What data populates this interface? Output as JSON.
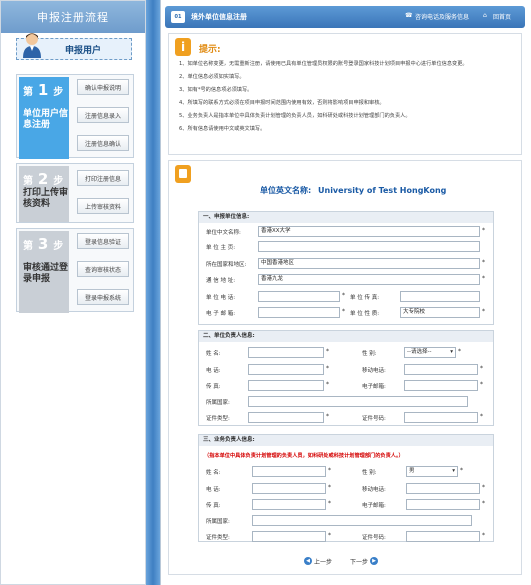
{
  "sidebar": {
    "title": "申报注册流程",
    "user_label": "申报用户",
    "steps": [
      {
        "num": "第",
        "digit": "1",
        "suffix": "步",
        "label": "单位用户信息注册",
        "buttons": [
          "确认申报说明",
          "注册信息录入",
          "注册信息确认"
        ],
        "color": "#49a7e6"
      },
      {
        "num": "第",
        "digit": "2",
        "suffix": "步",
        "label": "打印上传审核资料",
        "buttons": [
          "打印注册信息",
          "上传审核资料"
        ],
        "color": "#c9cfd6"
      },
      {
        "num": "第",
        "digit": "3",
        "suffix": "步",
        "label": "审核通过登录申报",
        "buttons": [
          "登录信息验证",
          "查询审核状态",
          "登录申报系统"
        ],
        "color": "#c9cfd6"
      }
    ]
  },
  "topbar": {
    "badge": "01",
    "title": "境外单位信息注册",
    "link1": "咨询电话及服务信息",
    "link2": "回首页"
  },
  "tips": {
    "head": "提示:",
    "items": [
      "1、如单位名称变更，无需重新注册，请使用已具有单位管理员权限的账号登录国家科技计划项目申报中心进行单位信息变更。",
      "2、单位信息必须如实填写。",
      "3、如有*号的信息项必须填写。",
      "4、所填写的联系方式必须在项目申报时间范围内使用有效，否则将影响项目申报和审核。",
      "5、业务负责人是指本单位中具体负责计划管理的负责人员，如科研处或科技计划管理部门的负责人。",
      "6、所有信息请使用中文或英文填写。"
    ]
  },
  "form": {
    "en_label": "单位英文名称:",
    "en_value": "University of Test HongKong",
    "sec1": {
      "title": "一、申报单位信息:",
      "cn_name_label": "单位中文名称:",
      "cn_name": "香港XX大学",
      "dept_label": "单  位  主  页:",
      "region_label": "所在国家和地区:",
      "region": "中国香港地区",
      "addr_label": "通  信  地  址:",
      "addr": "香港九龙",
      "phone_label": "单  位  电  话:",
      "fax_label": "单  位  传  真:",
      "email_label": "电  子  邮  箱:",
      "nature_label": "单  位  性  质:",
      "nature": "大专院校"
    },
    "sec2": {
      "title": "二、单位负责人信息:",
      "name_label": "姓     名:",
      "gender_label": "性     别:",
      "gender": "--请选择--",
      "tel_label": "电     话:",
      "mobile_label": "移动电话:",
      "fax_label": "传     真:",
      "email_label": "电子邮箱:",
      "country_label": "所属国家:",
      "id_type_label": "证件类型:",
      "id_no_label": "证件号码:"
    },
    "sec3": {
      "title": "三、业务负责人信息:",
      "note": "（指本单位中具体负责计划管理的负责人员，如科研处或科技计划管理部门的负责人。）",
      "name_label": "姓     名:",
      "gender_label": "性     别:",
      "gender": "男",
      "tel_label": "电     话:",
      "mobile_label": "移动电话:",
      "fax_label": "传     真:",
      "email_label": "电子邮箱:",
      "country_label": "所属国家:",
      "id_type_label": "证件类型:",
      "id_no_label": "证件号码:"
    },
    "prev": "上一步",
    "next": "下一步"
  }
}
